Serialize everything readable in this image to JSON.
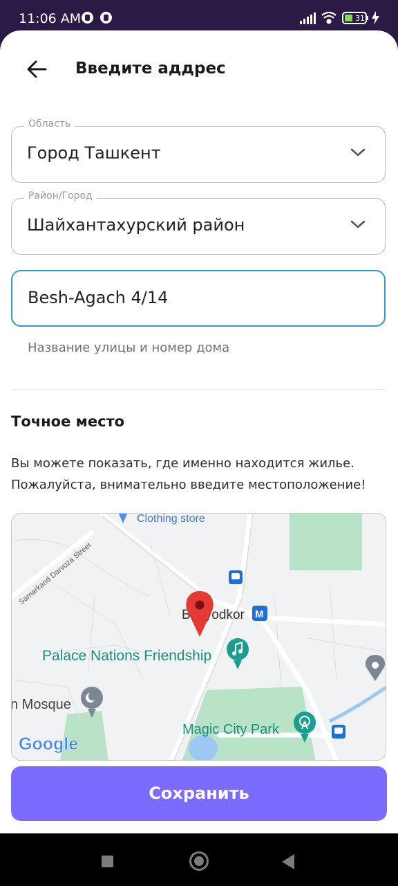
{
  "status_bar": {
    "time": "11:06 AM",
    "battery": "31",
    "icons": [
      "notification-icon",
      "notification-icon",
      "signal-icon",
      "wifi-icon",
      "battery-icon",
      "charging-icon"
    ]
  },
  "header": {
    "title": "Введите аддрес",
    "back_icon": "arrow-left-icon"
  },
  "form": {
    "region": {
      "label": "Область",
      "value": "Город Ташкент"
    },
    "district": {
      "label": "Район/Город",
      "value": "Шайхантахурский район"
    },
    "street": {
      "value": "Besh-Agach 4/14",
      "hint": "Название улицы и номер дома"
    }
  },
  "location_section": {
    "title": "Точное место",
    "description": "Вы можете показать, где именно находится жилье. Пожалуйста, внимательно введите местоположение!"
  },
  "map": {
    "labels": {
      "clothing": "Clothing store",
      "street": "Samarkand Darvoza Street",
      "metro": "Bunyodkor",
      "metro_letter": "M",
      "palace": "Palace Nations Friendship",
      "mosque": "n Mosque",
      "park": "Magic City Park",
      "google": "Google"
    },
    "colors": {
      "park": "#b7e2c3",
      "road": "#ffffff",
      "water": "#9cc9f2",
      "pin": "#e53935",
      "poi_teal": "#1a9e8f"
    }
  },
  "save_button": {
    "label": "Сохранить",
    "color": "#7b6bff"
  },
  "nav_bar": {
    "icons": [
      "recents-square-icon",
      "home-circle-icon",
      "back-triangle-icon"
    ]
  }
}
